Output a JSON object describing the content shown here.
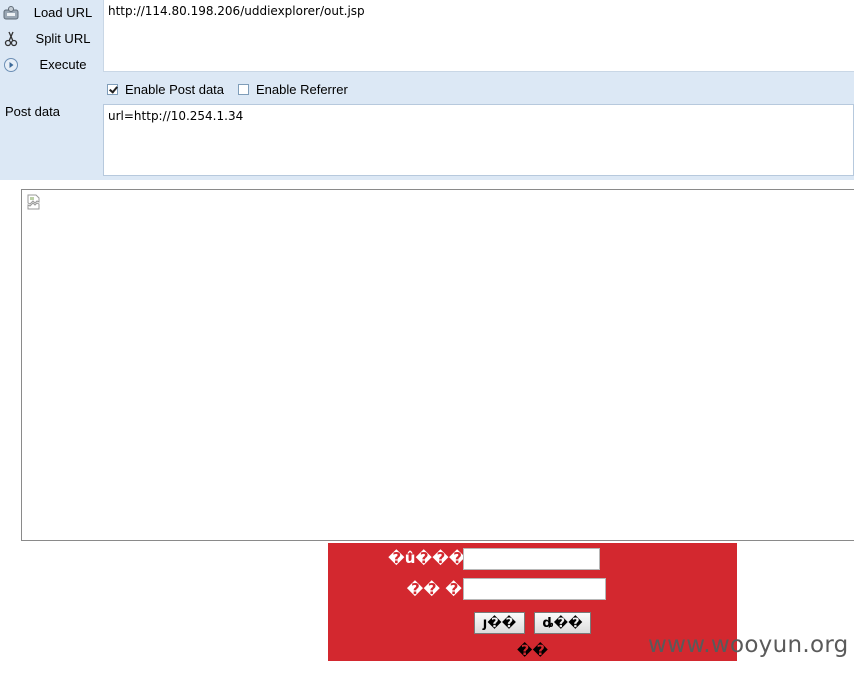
{
  "toolbar": {
    "load_url_label": "Load URL",
    "split_url_label": "Split URL",
    "execute_label": "Execute",
    "url_value": "http://114.80.198.206/uddiexplorer/out.jsp",
    "enable_post_label": "Enable Post data",
    "enable_post_checked": true,
    "enable_referrer_label": "Enable Referrer",
    "enable_referrer_checked": false,
    "post_data_label": "Post data",
    "post_data_value": "url=http://10.254.1.34"
  },
  "login": {
    "username_label": "�û���",
    "password_label": "�� �",
    "submit_label": "ȷ��",
    "reset_label": "ȡ��",
    "footer_text": "��",
    "background_color": "#d3282f"
  },
  "watermark": "www.wooyun.org"
}
